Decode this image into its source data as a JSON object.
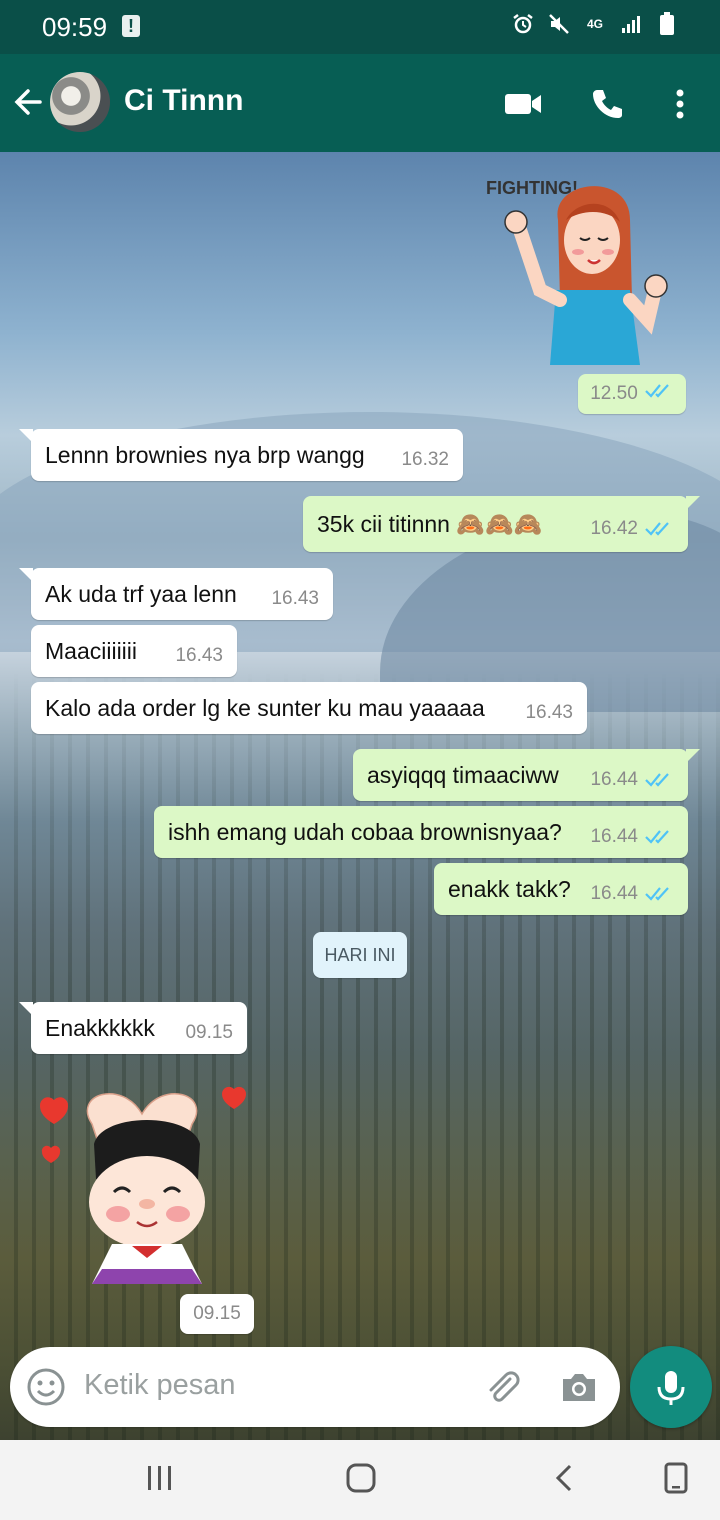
{
  "status_bar": {
    "time": "09:59",
    "network": "4G",
    "icons": [
      "alert-icon",
      "alarm-icon",
      "mute-icon",
      "network-4g-icon",
      "signal-icon",
      "battery-icon"
    ]
  },
  "header": {
    "contact_name": "Ci Tinnn",
    "icons": [
      "back-arrow-icon",
      "avatar",
      "video-call-icon",
      "voice-call-icon",
      "more-options-icon"
    ]
  },
  "stickers": {
    "fighting_text": "FIGHTING!"
  },
  "messages": [
    {
      "dir": "out",
      "text": "",
      "time": "12.50",
      "read": true,
      "type": "sticker"
    },
    {
      "dir": "in",
      "text": "Lennn brownies nya brp wangg",
      "time": "16.32"
    },
    {
      "dir": "out",
      "text": "35k cii titinnn 🙈🙈🙈",
      "time": "16.42",
      "read": true
    },
    {
      "dir": "in",
      "text": "Ak uda trf yaa lenn",
      "time": "16.43"
    },
    {
      "dir": "in",
      "text": "Maaciiiiiii",
      "time": "16.43"
    },
    {
      "dir": "in",
      "text": "Kalo ada order lg ke sunter ku mau yaaaaa",
      "time": "16.43"
    },
    {
      "dir": "out",
      "text": "asyiqqq timaaciww",
      "time": "16.44",
      "read": true
    },
    {
      "dir": "out",
      "text": "ishh emang udah cobaa brownisnyaa?",
      "time": "16.44",
      "read": true
    },
    {
      "dir": "out",
      "text": "enakk takk?",
      "time": "16.44",
      "read": true
    },
    {
      "dir": "in",
      "text": "Enakkkkkk",
      "time": "09.15"
    },
    {
      "dir": "in",
      "text": "",
      "time": "09.15",
      "type": "sticker"
    }
  ],
  "day_separator": "HARI INI",
  "composer": {
    "placeholder": "Ketik pesan",
    "icons": [
      "emoji-icon",
      "attach-icon",
      "camera-icon",
      "mic-icon"
    ]
  },
  "nav_bar": {
    "icons": [
      "recent-apps-icon",
      "home-icon",
      "back-icon",
      "keyboard-toggle-icon"
    ]
  },
  "colors": {
    "header": "#075e54",
    "status_bar": "#0a4f48",
    "outgoing_bubble": "#dcf8c6",
    "incoming_bubble": "#ffffff",
    "read_ticks": "#4fc3f7",
    "mic_button": "#128c7e"
  }
}
